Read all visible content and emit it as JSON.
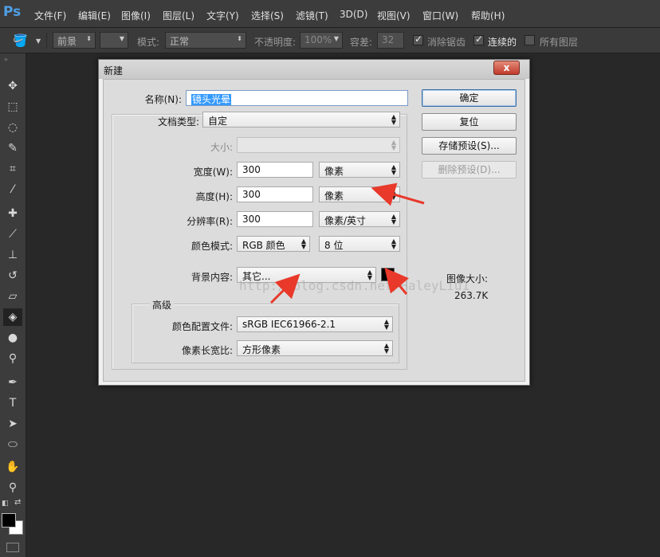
{
  "app": {
    "logo": "Ps"
  },
  "menu": {
    "items": [
      "文件(F)",
      "编辑(E)",
      "图像(I)",
      "图层(L)",
      "文字(Y)",
      "选择(S)",
      "滤镜(T)",
      "3D(D)",
      "视图(V)",
      "窗口(W)",
      "帮助(H)"
    ]
  },
  "options": {
    "preset_label": "前景",
    "mode_label": "模式:",
    "mode_value": "正常",
    "opacity_label": "不透明度:",
    "opacity_value": "100%",
    "tolerance_label": "容差:",
    "tolerance_value": "32",
    "antialias_label": "消除锯齿",
    "antialias_checked": true,
    "contiguous_label": "连续的",
    "contiguous_checked": true,
    "all_layers_label": "所有图层",
    "all_layers_checked": false
  },
  "dialog": {
    "title": "新建",
    "close_label": "x",
    "name_label": "名称(N):",
    "name_value": "镜头光晕",
    "doc_type_label": "文档类型:",
    "doc_type_value": "自定",
    "size_label": "大小:",
    "size_value": "",
    "width_label": "宽度(W):",
    "width_value": "300",
    "width_unit": "像素",
    "height_label": "高度(H):",
    "height_value": "300",
    "height_unit": "像素",
    "resolution_label": "分辨率(R):",
    "resolution_value": "300",
    "resolution_unit": "像素/英寸",
    "color_mode_label": "颜色模式:",
    "color_mode_value": "RGB 颜色",
    "bit_depth_value": "8 位",
    "background_label": "背景内容:",
    "background_value": "其它...",
    "background_color": "#000000",
    "advanced_title": "高级",
    "color_profile_label": "颜色配置文件:",
    "color_profile_value": "sRGB IEC61966-2.1",
    "pixel_aspect_label": "像素长宽比:",
    "pixel_aspect_value": "方形像素",
    "buttons": {
      "ok": "确定",
      "reset": "复位",
      "save_preset": "存储预设(S)...",
      "delete_preset": "删除预设(D)..."
    },
    "image_size_label": "图像大小:",
    "image_size_value": "263.7K"
  },
  "watermark": "http://blog.csdn.net/HaleyLiu1",
  "colors": {
    "annotation_arrow": "#e8392a",
    "foreground": "#000000",
    "background": "#ffffff"
  }
}
